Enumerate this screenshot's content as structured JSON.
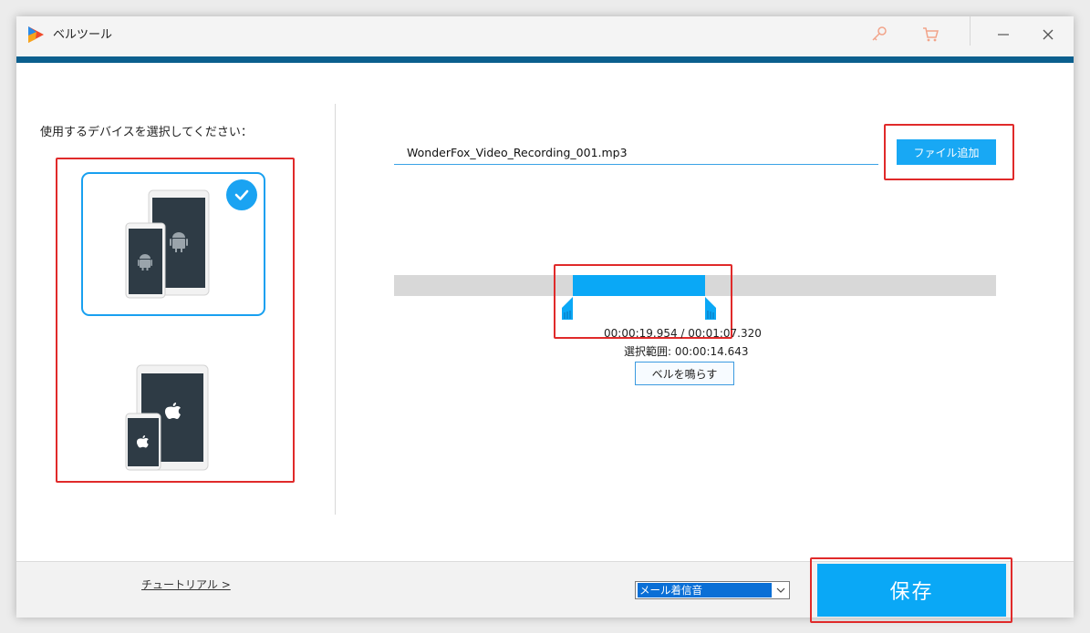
{
  "window": {
    "title": "ベルツール"
  },
  "left_panel": {
    "label": "使用するデバイスを選択してください：",
    "devices": [
      {
        "name": "Android",
        "selected": true
      },
      {
        "name": "Apple",
        "selected": false
      }
    ]
  },
  "file": {
    "path": "WonderFox_Video_Recording_001.mp3",
    "add_button": "ファイル追加"
  },
  "trim": {
    "time_text": "00:00:19.954 / 00:01:07.320",
    "range_text": "選択範囲: 00:00:14.643",
    "ring_button": "ベルを鳴らす"
  },
  "footer": {
    "tutorial_link": "チュートリアル >",
    "ringtone_type": "メール着信音",
    "save_button": "保存"
  },
  "colors": {
    "accent": "#0aa8f6",
    "header_bar": "#0b5f8e",
    "highlight_box": "#e02a2a"
  }
}
